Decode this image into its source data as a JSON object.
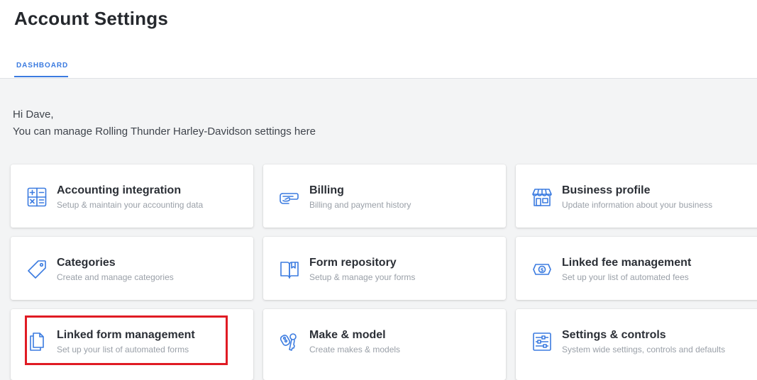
{
  "header": {
    "title": "Account Settings",
    "tabs": [
      {
        "label": "DASHBOARD",
        "active": true
      }
    ]
  },
  "greeting": {
    "line1": "Hi Dave,",
    "line2": "You can manage Rolling Thunder Harley-Davidson settings here"
  },
  "colors": {
    "accent": "#3b7be0",
    "icon": "#3b7be0",
    "highlight": "#e01b24",
    "background": "#f3f4f5"
  },
  "cards": [
    {
      "title": "Accounting integration",
      "desc": "Setup & maintain your accounting data",
      "icon": "calculator-icon"
    },
    {
      "title": "Billing",
      "desc": "Billing and payment history",
      "icon": "credit-card-icon"
    },
    {
      "title": "Business profile",
      "desc": "Update information about your business",
      "icon": "storefront-icon"
    },
    {
      "title": "Categories",
      "desc": "Create and manage categories",
      "icon": "tag-icon"
    },
    {
      "title": "Form repository",
      "desc": "Setup & manage your forms",
      "icon": "book-icon"
    },
    {
      "title": "Linked fee management",
      "desc": "Set up your list of automated fees",
      "icon": "dollar-bill-icon"
    },
    {
      "title": "Linked form management",
      "desc": "Set up your list of automated forms",
      "icon": "documents-icon",
      "highlighted": true
    },
    {
      "title": "Make & model",
      "desc": "Create makes & models",
      "icon": "keys-icon"
    },
    {
      "title": "Settings & controls",
      "desc": "System wide settings, controls and defaults",
      "icon": "sliders-icon"
    }
  ]
}
